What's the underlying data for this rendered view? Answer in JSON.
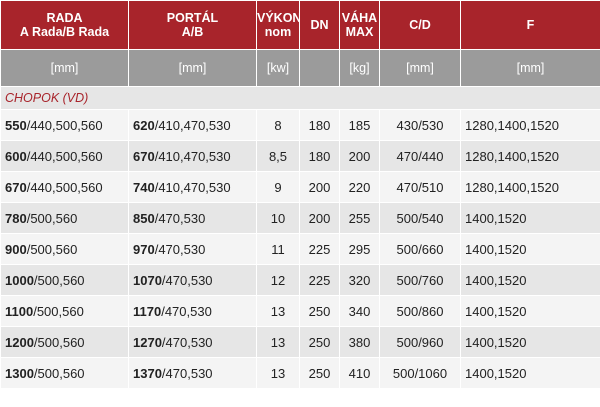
{
  "headers": [
    {
      "line1": "RADA",
      "line2": "A Rada/B Rada"
    },
    {
      "line1": "PORTÁL",
      "line2": "A/B"
    },
    {
      "line1": "VÝKON",
      "line2": "nom"
    },
    {
      "line1": "DN",
      "line2": ""
    },
    {
      "line1": "VÁHA",
      "line2": "MAX"
    },
    {
      "line1": "C/D",
      "line2": ""
    },
    {
      "line1": "F",
      "line2": ""
    }
  ],
  "units": [
    "[mm]",
    "[mm]",
    "[kw]",
    "",
    "[kg]",
    "[mm]",
    "[mm]"
  ],
  "section_label": "CHOPOK (VD)",
  "rows": [
    {
      "rada_bold": "550",
      "rada_rest": "/440,500,560",
      "portal_bold": "620",
      "portal_rest": "/410,470,530",
      "vykon": "8",
      "dn": "180",
      "vaha": "185",
      "cd": "430/530",
      "f": "1280,1400,1520"
    },
    {
      "rada_bold": "600",
      "rada_rest": "/440,500,560",
      "portal_bold": "670",
      "portal_rest": "/410,470,530",
      "vykon": "8,5",
      "dn": "180",
      "vaha": "200",
      "cd": "470/440",
      "f": "1280,1400,1520"
    },
    {
      "rada_bold": "670",
      "rada_rest": "/440,500,560",
      "portal_bold": "740",
      "portal_rest": "/410,470,530",
      "vykon": "9",
      "dn": "200",
      "vaha": "220",
      "cd": "470/510",
      "f": "1280,1400,1520"
    },
    {
      "rada_bold": "780",
      "rada_rest": "/500,560",
      "portal_bold": "850",
      "portal_rest": "/470,530",
      "vykon": "10",
      "dn": "200",
      "vaha": "255",
      "cd": "500/540",
      "f": "1400,1520"
    },
    {
      "rada_bold": "900",
      "rada_rest": "/500,560",
      "portal_bold": "970",
      "portal_rest": "/470,530",
      "vykon": "11",
      "dn": "225",
      "vaha": "295",
      "cd": "500/660",
      "f": "1400,1520"
    },
    {
      "rada_bold": "1000",
      "rada_rest": "/500,560",
      "portal_bold": "1070",
      "portal_rest": "/470,530",
      "vykon": "12",
      "dn": "225",
      "vaha": "320",
      "cd": "500/760",
      "f": "1400,1520"
    },
    {
      "rada_bold": "1100",
      "rada_rest": "/500,560",
      "portal_bold": "1170",
      "portal_rest": "/470,530",
      "vykon": "13",
      "dn": "250",
      "vaha": "340",
      "cd": "500/860",
      "f": "1400,1520"
    },
    {
      "rada_bold": "1200",
      "rada_rest": "/500,560",
      "portal_bold": "1270",
      "portal_rest": "/470,530",
      "vykon": "13",
      "dn": "250",
      "vaha": "380",
      "cd": "500/960",
      "f": "1400,1520"
    },
    {
      "rada_bold": "1300",
      "rada_rest": "/500,560",
      "portal_bold": "1370",
      "portal_rest": "/470,530",
      "vykon": "13",
      "dn": "250",
      "vaha": "410",
      "cd": "500/1060",
      "f": "1400,1520"
    }
  ],
  "colors": {
    "header_red": "#a8242b",
    "units_gray": "#9b9b9b",
    "row_light": "#f4f4f4",
    "row_dark": "#e6e6e6"
  }
}
